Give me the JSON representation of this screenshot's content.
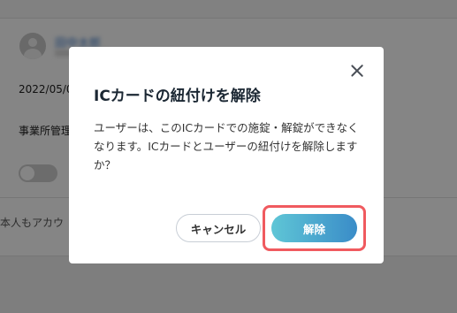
{
  "background": {
    "user_name": "田中太郎",
    "date_text": "2022/05/0",
    "admin_label": "事業所管理",
    "note_text": "本人もアカウ"
  },
  "dialog": {
    "title": "ICカードの紐付けを解除",
    "message": "ユーザーは、このICカードでの施錠・解錠ができなくなります。ICカードとユーザーの紐付けを解除しますか？",
    "close_icon": "close-icon",
    "cancel_label": "キャンセル",
    "confirm_label": "解除"
  },
  "colors": {
    "confirm_gradient_start": "#5fc6d6",
    "confirm_gradient_end": "#3a8cc8",
    "highlight": "#f05a5f"
  }
}
